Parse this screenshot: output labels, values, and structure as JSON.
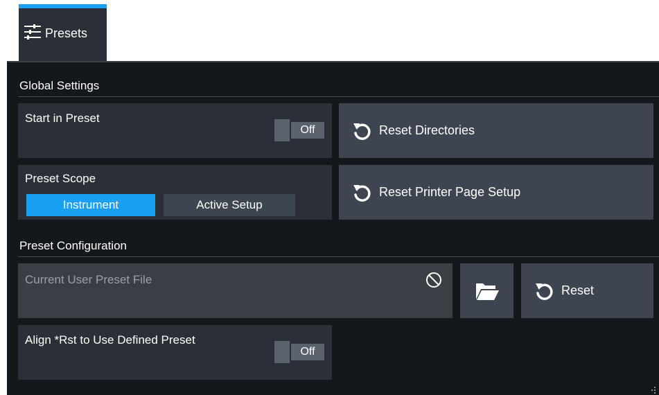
{
  "tab": {
    "label": "Presets"
  },
  "global_settings": {
    "title": "Global Settings",
    "start_in_preset": {
      "label": "Start in Preset",
      "value": "Off"
    },
    "preset_scope": {
      "label": "Preset Scope",
      "options": [
        "Instrument",
        "Active Setup"
      ],
      "selected": "Instrument"
    },
    "reset_directories_label": "Reset Directories",
    "reset_printer_label": "Reset Printer Page Setup"
  },
  "preset_configuration": {
    "title": "Preset Configuration",
    "user_preset_file": {
      "placeholder": "Current User Preset File",
      "value": ""
    },
    "reset_label": "Reset",
    "align_rst": {
      "label": "Align *Rst to Use Defined Preset",
      "value": "Off"
    }
  },
  "colors": {
    "accent": "#1aa0f2",
    "panel": "#14181d",
    "card": "#2b3038",
    "button": "#3d4650"
  },
  "icons": {
    "tab": "sliders-icon",
    "reset": "reset-arrow-icon",
    "clear": "clear-icon",
    "folder": "folder-open-icon"
  }
}
